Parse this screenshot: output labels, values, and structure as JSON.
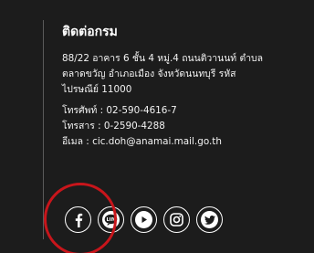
{
  "contact": {
    "title": "ติดต่อกรม",
    "address_lines": [
      "88/22 อาคาร 6 ชั้น 4 หมู่.4 ถนนติวานนท์ ตำบล",
      "ตลาดขวัญ อำเภอเมือง จังหวัดนนทบุรี รหัส",
      "ไปรษณีย์ 11000"
    ],
    "phone": "โทรศัพท์ : 02-590-4616-7",
    "fax": "โทรสาร : 0-2590-4288",
    "email": "อีเมล : cic.doh@anamai.mail.go.th"
  },
  "social_icons": [
    {
      "icon": "facebook-icon"
    },
    {
      "icon": "line-icon"
    },
    {
      "icon": "youtube-icon"
    },
    {
      "icon": "instagram-icon"
    },
    {
      "icon": "twitter-icon"
    }
  ],
  "colors": {
    "background": "#1c1c1c",
    "text": "#ffffff",
    "divider": "#5a5a5a",
    "annotation": "#c8151b"
  }
}
